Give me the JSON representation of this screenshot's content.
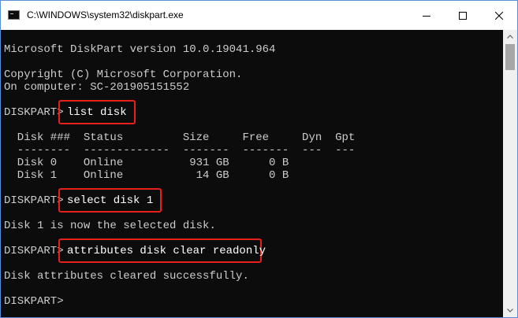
{
  "window": {
    "title": "C:\\WINDOWS\\system32\\diskpart.exe",
    "minimize_icon": "minimize-icon",
    "maximize_icon": "maximize-icon",
    "close_icon": "close-icon"
  },
  "console": {
    "lines": [
      "Microsoft DiskPart version 10.0.19041.964",
      "Copyright (C) Microsoft Corporation.",
      "On computer: SC-201905151552",
      "DISKPART>",
      "  Disk ###  Status         Size     Free     Dyn  Gpt",
      "  --------  -------------  -------  -------  ---  ---",
      "  Disk 0    Online          931 GB      0 B",
      "  Disk 1    Online           14 GB      0 B",
      "DISKPART>",
      "Disk 1 is now the selected disk.",
      "DISKPART>",
      "Disk attributes cleared successfully.",
      "DISKPART>"
    ],
    "commands": [
      "list disk",
      "select disk 1",
      "attributes disk clear readonly"
    ]
  },
  "colors": {
    "console_bg": "#0c0c0c",
    "console_text": "#cccccc",
    "highlight_box": "#e8201a"
  }
}
